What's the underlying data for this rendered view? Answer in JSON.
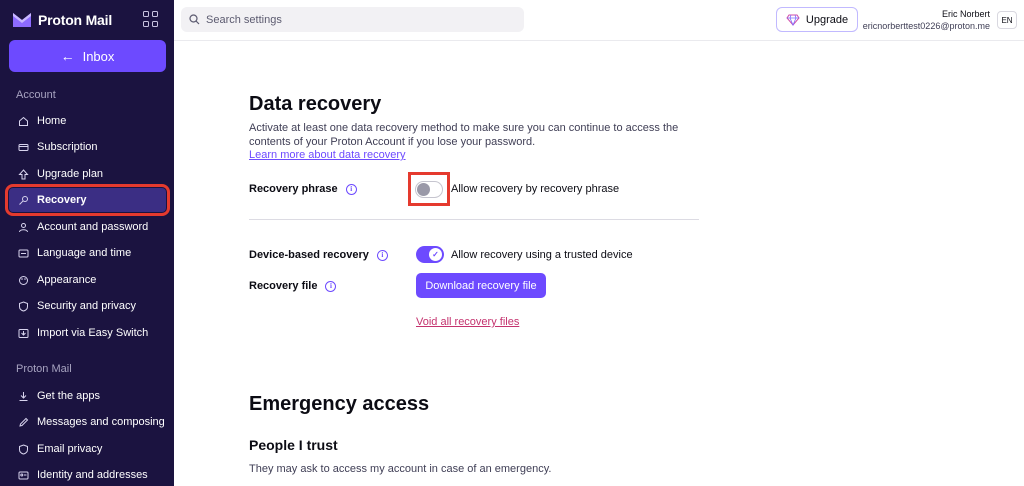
{
  "brand": {
    "name": "Proton Mail"
  },
  "sidebar": {
    "inbox_label": "Inbox",
    "sections": [
      {
        "label": "Account"
      },
      {
        "label": "Proton Mail"
      }
    ],
    "account_items": [
      {
        "label": "Home",
        "icon": "home-icon"
      },
      {
        "label": "Subscription",
        "icon": "card-icon"
      },
      {
        "label": "Upgrade plan",
        "icon": "upgrade-icon"
      },
      {
        "label": "Recovery",
        "icon": "key-icon",
        "active": true
      },
      {
        "label": "Account and password",
        "icon": "user-icon"
      },
      {
        "label": "Language and time",
        "icon": "language-icon"
      },
      {
        "label": "Appearance",
        "icon": "paint-icon"
      },
      {
        "label": "Security and privacy",
        "icon": "shield-icon"
      },
      {
        "label": "Import via Easy Switch",
        "icon": "import-icon"
      }
    ],
    "mail_items": [
      {
        "label": "Get the apps",
        "icon": "download-icon"
      },
      {
        "label": "Messages and composing",
        "icon": "pen-icon"
      },
      {
        "label": "Email privacy",
        "icon": "shield-icon"
      },
      {
        "label": "Identity and addresses",
        "icon": "id-card-icon"
      }
    ]
  },
  "topbar": {
    "search_placeholder": "Search settings",
    "upgrade_label": "Upgrade",
    "user_name": "Eric Norbert",
    "user_email": "ericnorberttest0226@proton.me",
    "language": "EN"
  },
  "main": {
    "title": "Data recovery",
    "description": "Activate at least one data recovery method to make sure you can continue to access the contents of your Proton Account if you lose your password.",
    "learn_more": "Learn more about data recovery",
    "recovery_phrase": {
      "label": "Recovery phrase",
      "toggle_text": "Allow recovery by recovery phrase",
      "enabled": false
    },
    "device_recovery": {
      "label": "Device-based recovery",
      "toggle_text": "Allow recovery using a trusted device",
      "enabled": true
    },
    "recovery_file": {
      "label": "Recovery file",
      "button": "Download recovery file",
      "void_link": "Void all recovery files"
    },
    "emergency": {
      "title": "Emergency access",
      "subtitle": "People I trust",
      "description": "They may ask to access my account in case of an emergency."
    }
  },
  "colors": {
    "sidebar_bg": "#1b1340",
    "accent": "#6d4aff",
    "highlight": "#e53a2e"
  }
}
